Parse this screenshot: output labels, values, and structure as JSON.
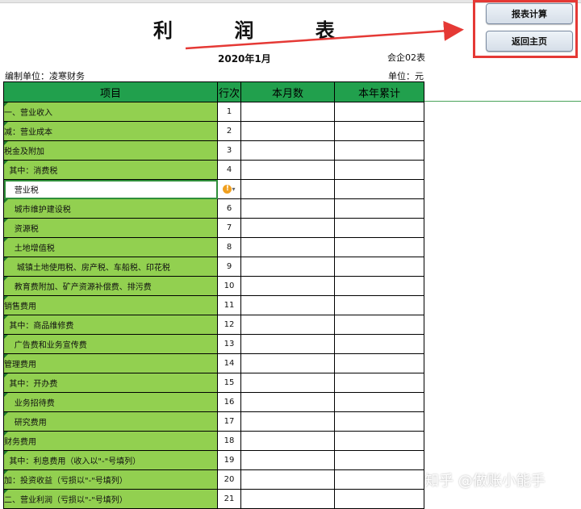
{
  "report": {
    "title": "利 润 表",
    "date": "2020年1月",
    "form_code": "会企02表",
    "compiler": "编制单位：凌寒财务",
    "unit": "单位：元"
  },
  "buttons": {
    "calc": "报表计算",
    "home": "返回主页"
  },
  "table": {
    "headers": [
      "项目",
      "行次",
      "本月数",
      "本年累计"
    ],
    "rows": [
      {
        "item": "一、营业收入",
        "line": "1"
      },
      {
        "item": "减：营业成本",
        "line": "2"
      },
      {
        "item": "税金及附加",
        "line": "3"
      },
      {
        "item": "  其中：消费税",
        "line": "4"
      },
      {
        "item": "    营业税",
        "line": ""
      },
      {
        "item": "    城市维护建设税",
        "line": "6"
      },
      {
        "item": "    资源税",
        "line": "7"
      },
      {
        "item": "    土地增值税",
        "line": "8"
      },
      {
        "item": "     城镇土地使用税、房产税、车船税、印花税",
        "line": "9"
      },
      {
        "item": "    教育费附加、矿产资源补偿费、排污费",
        "line": "10"
      },
      {
        "item": "销售费用",
        "line": "11"
      },
      {
        "item": "  其中：商品维修费",
        "line": "12"
      },
      {
        "item": "    广告费和业务宣传费",
        "line": "13"
      },
      {
        "item": "管理费用",
        "line": "14"
      },
      {
        "item": "  其中：开办费",
        "line": "15"
      },
      {
        "item": "    业务招待费",
        "line": "16"
      },
      {
        "item": "    研究费用",
        "line": "17"
      },
      {
        "item": "财务费用",
        "line": "18"
      },
      {
        "item": "  其中：利息费用（收入以\"-\"号填列）",
        "line": "19"
      },
      {
        "item": "加：投资收益（亏损以\"-\"号填列）",
        "line": "20"
      },
      {
        "item": "二、营业利润（亏损以\"-\"号填列）",
        "line": "21"
      }
    ]
  },
  "watermark": "知乎 @做账小能手",
  "colors": {
    "header_green": "#21a04d",
    "item_green": "#92d050",
    "annotation_red": "#e53935"
  }
}
